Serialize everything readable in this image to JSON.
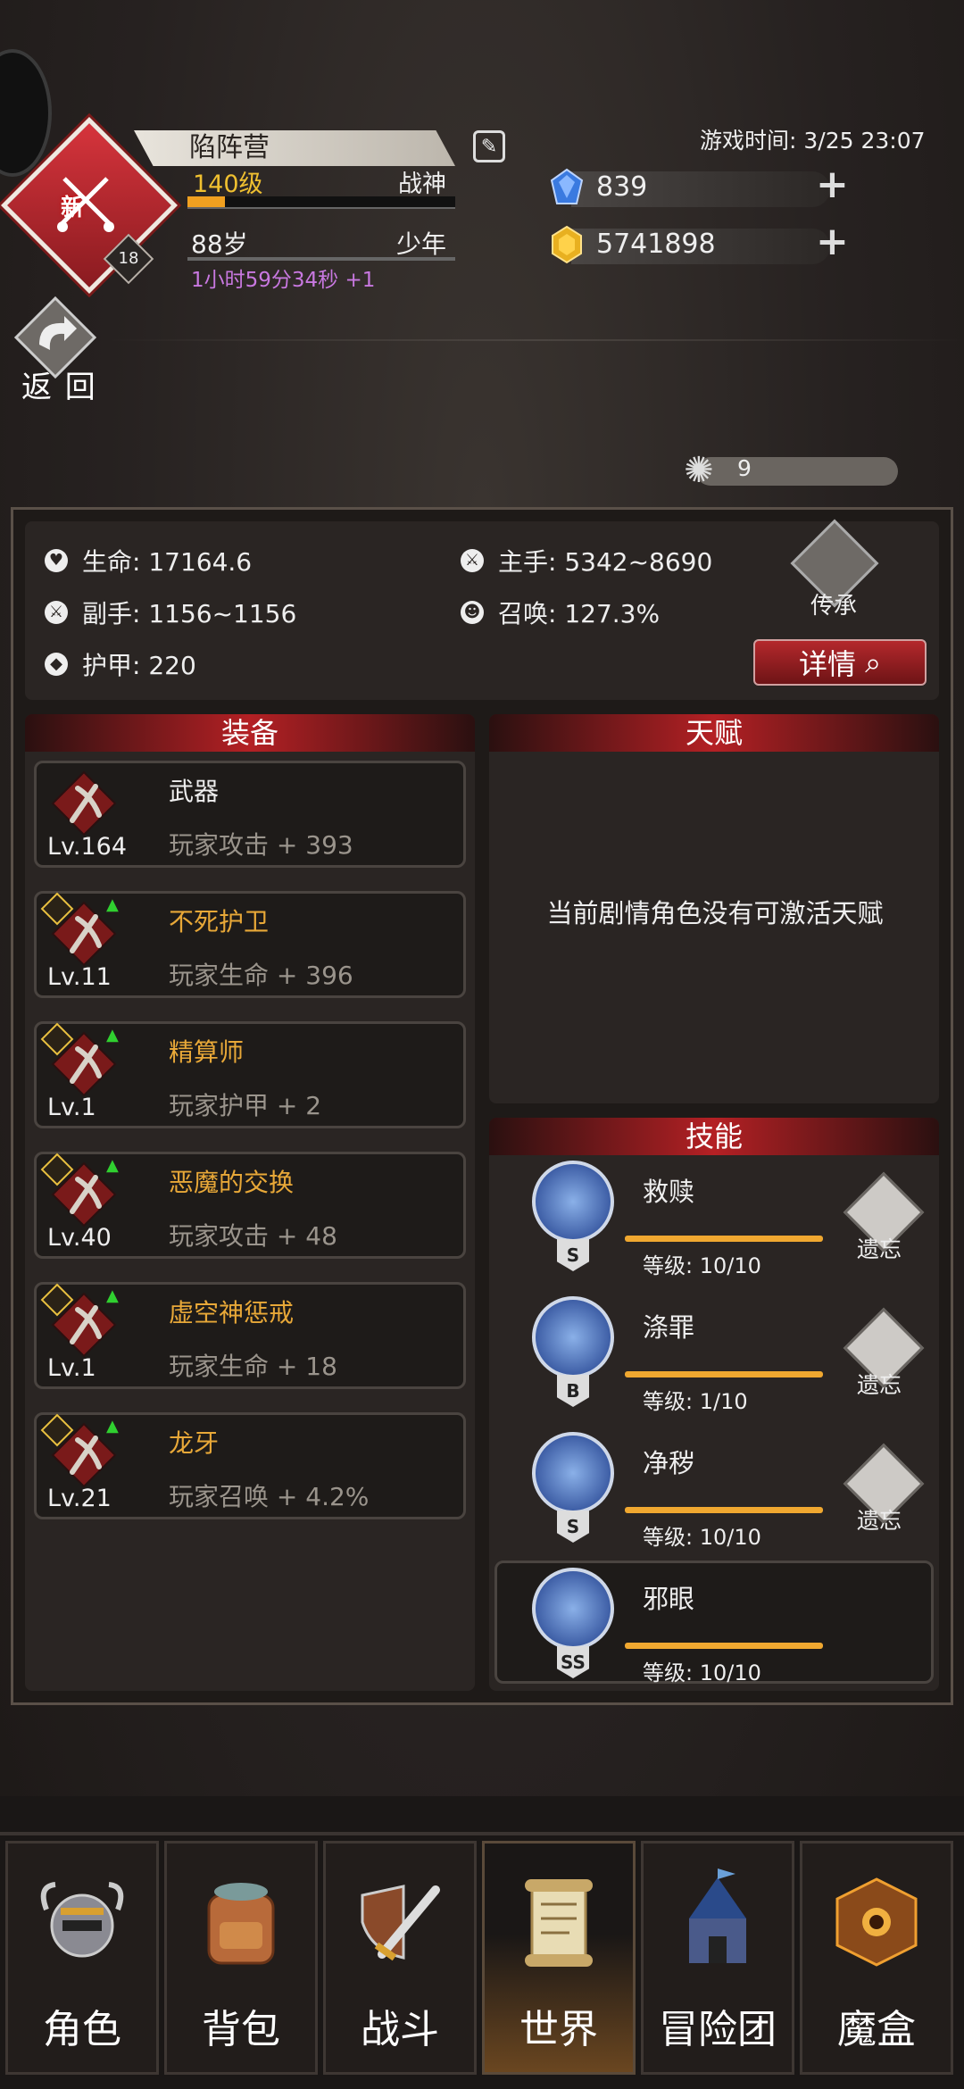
{
  "header": {
    "faction_name": "陷阵营",
    "level": "140级",
    "title": "战神",
    "age": "88岁",
    "life_stage": "少年",
    "timer": "1小时59分34秒 +1",
    "rank_new_label": "新",
    "rank_level": "18",
    "xp_progress": 0.14,
    "game_time": "游戏时间: 3/25 23:07"
  },
  "resources": {
    "gems": "839",
    "gold": "5741898"
  },
  "back_label": "返 回",
  "spark_count": "9",
  "stats": {
    "hp": "生命: 17164.6",
    "main_hand": "主手: 5342~8690",
    "off_hand": "副手: 1156~1156",
    "summon": "召唤: 127.3%",
    "armor": "护甲: 220",
    "inherit_label": "传承",
    "detail_label": "详情"
  },
  "equipment": {
    "title": "装备",
    "items": [
      {
        "name": "武器",
        "level": "Lv.164",
        "stat": "玩家攻击 + 393"
      },
      {
        "name": "不死护卫",
        "level": "Lv.11",
        "stat": "玩家生命 + 396"
      },
      {
        "name": "精算师",
        "level": "Lv.1",
        "stat": "玩家护甲 + 2"
      },
      {
        "name": "恶魔的交换",
        "level": "Lv.40",
        "stat": "玩家攻击 + 48"
      },
      {
        "name": "虚空神惩戒",
        "level": "Lv.1",
        "stat": "玩家生命 + 18"
      },
      {
        "name": "龙牙",
        "level": "Lv.21",
        "stat": "玩家召唤 + 4.2%"
      }
    ]
  },
  "talent": {
    "title": "天赋",
    "message": "当前剧情角色没有可激活天赋"
  },
  "skills": {
    "title": "技能",
    "forget_label": "遗忘",
    "items": [
      {
        "name": "救赎",
        "grade": "S",
        "level": "等级: 10/10"
      },
      {
        "name": "涤罪",
        "grade": "B",
        "level": "等级: 1/10"
      },
      {
        "name": "净秽",
        "grade": "S",
        "level": "等级: 10/10"
      },
      {
        "name": "邪眼",
        "grade": "SS",
        "level": "等级: 10/10"
      }
    ]
  },
  "nav": {
    "tabs": [
      {
        "label": "角色"
      },
      {
        "label": "背包"
      },
      {
        "label": "战斗"
      },
      {
        "label": "世界"
      },
      {
        "label": "冒险团"
      },
      {
        "label": "魔盒"
      }
    ],
    "active": "世界"
  },
  "colors": {
    "accent_red": "#b42024",
    "gold_text": "#f0c030",
    "equip_name": "#e8a838",
    "timer_purple": "#c878e0"
  }
}
